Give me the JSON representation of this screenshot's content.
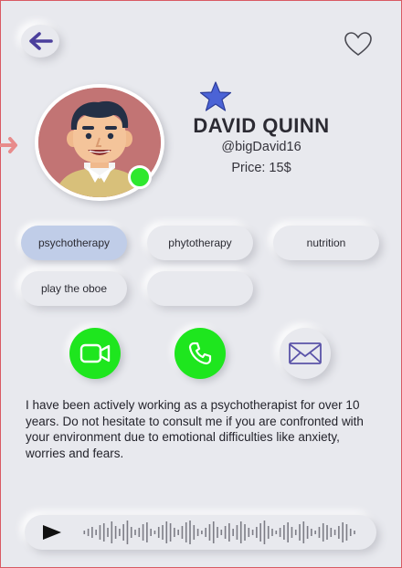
{
  "profile": {
    "name": "DAVID QUINN",
    "handle": "@bigDavid16",
    "price": "Price: 15$"
  },
  "tags": [
    {
      "label": "psychotherapy",
      "selected": true
    },
    {
      "label": "phytotherapy",
      "selected": false
    },
    {
      "label": "nutrition",
      "selected": false
    },
    {
      "label": "play the oboe",
      "selected": false
    },
    {
      "label": "",
      "selected": false
    }
  ],
  "actions": {
    "video_icon": "video-camera-icon",
    "phone_icon": "phone-icon",
    "message_icon": "envelope-icon"
  },
  "bio": "I have been actively working as a psychotherapist for over 10 years. Do not hesitate to consult me if you are confronted with your environment due to emotional difficulties like anxiety, worries and fears.",
  "audio": {
    "play_icon": "play-icon",
    "waveform": "audio-waveform"
  },
  "colors": {
    "background": "#e8e9ee",
    "accent_purple": "#4b3f9c",
    "star_blue": "#4b63d6",
    "online_green": "#2ee82e",
    "action_green": "#1ee61e",
    "chip_selected": "#c0cde8",
    "avatar_bg": "#c27474"
  }
}
